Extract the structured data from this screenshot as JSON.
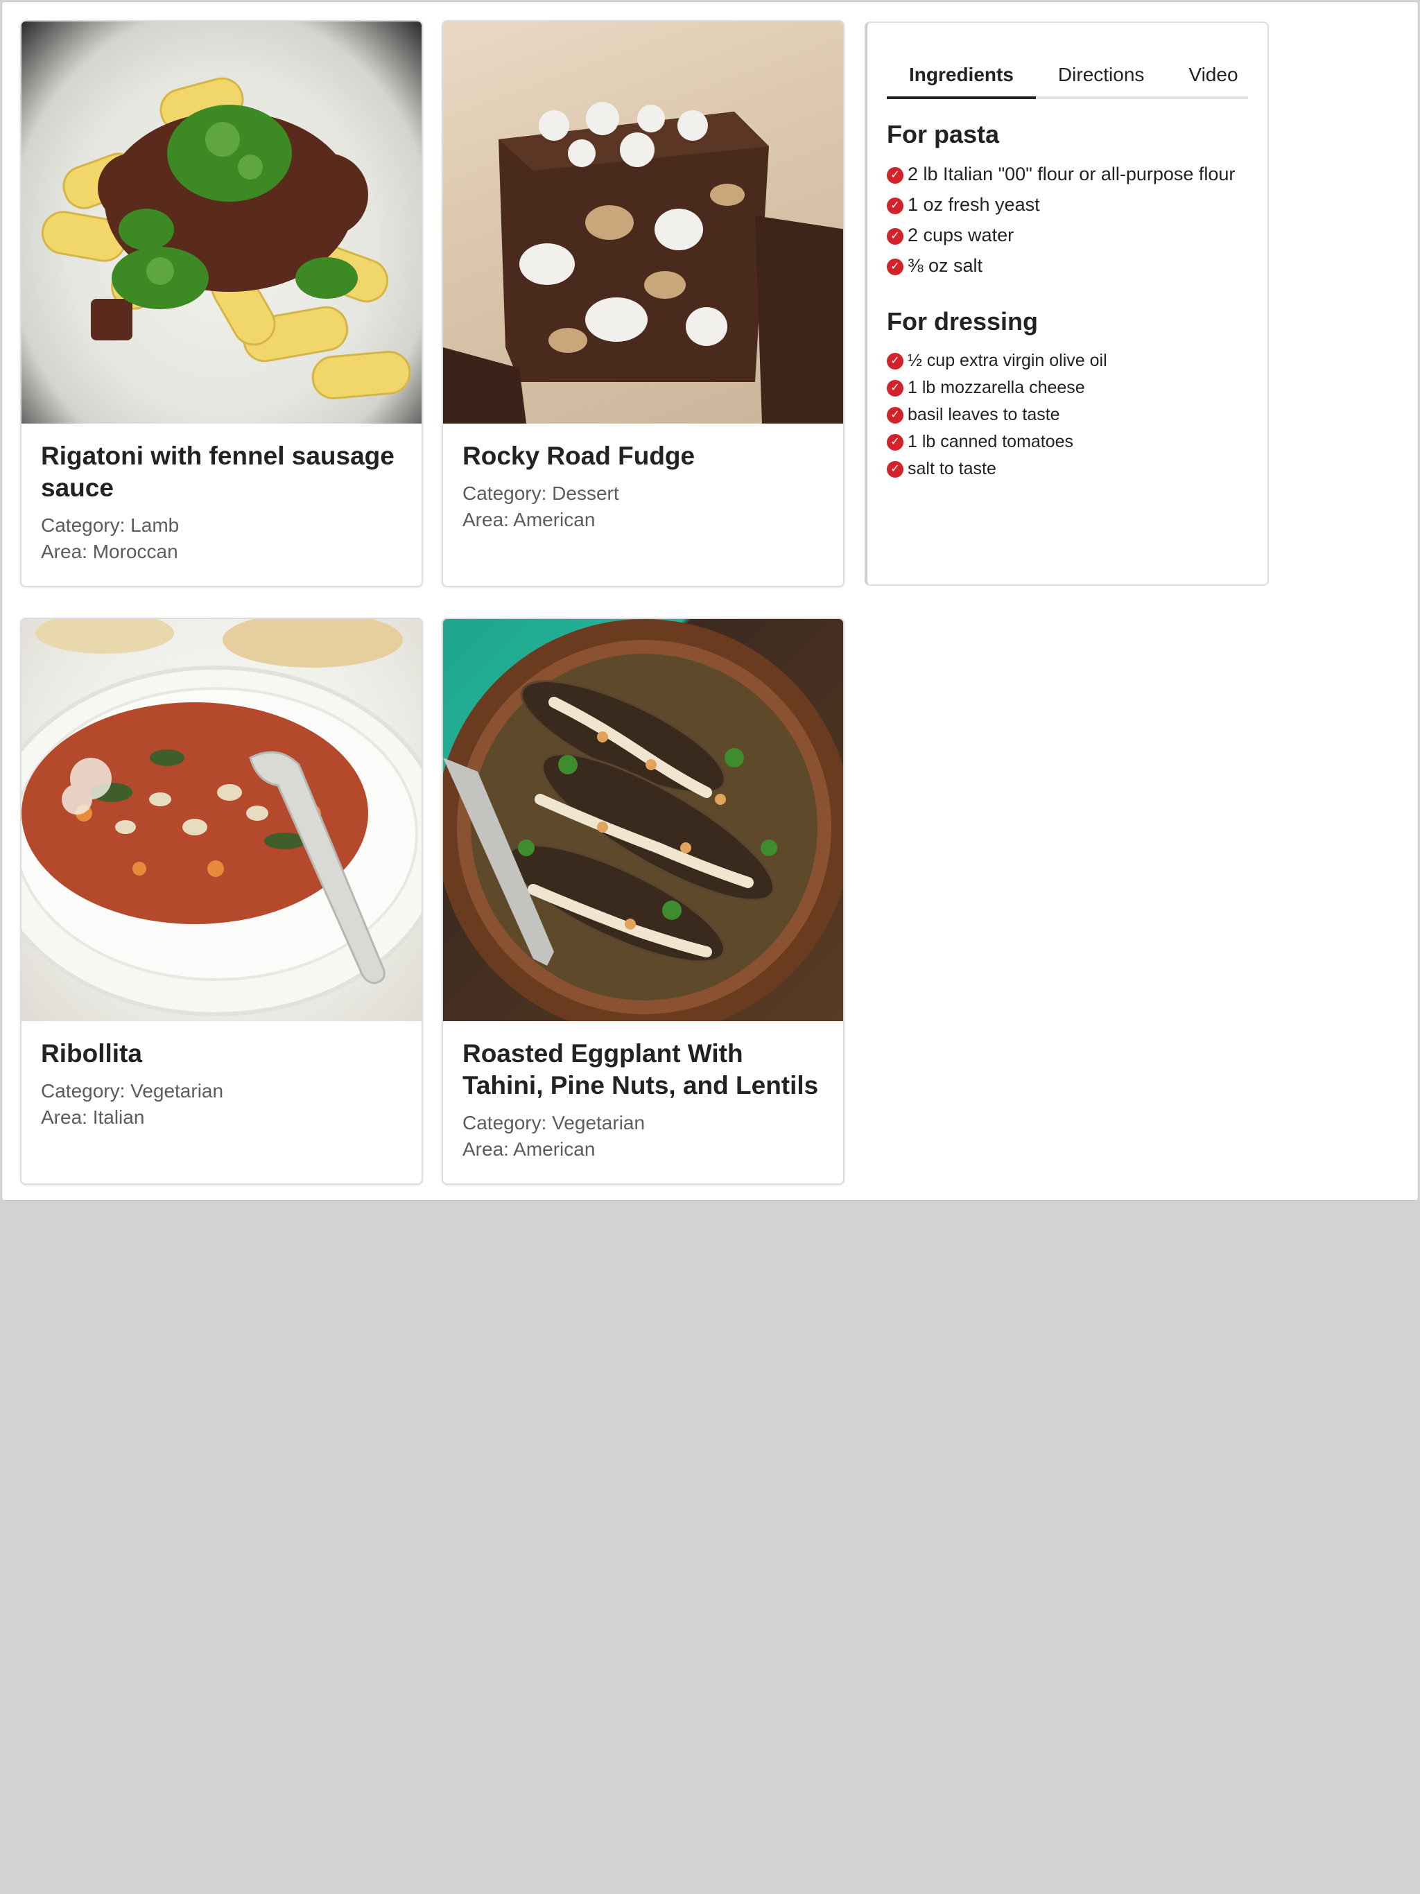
{
  "cards": [
    {
      "title": "Rigatoni with fennel sausage sauce",
      "category": "Category: Lamb",
      "area": "Area: Moroccan"
    },
    {
      "title": "Rocky Road Fudge",
      "category": "Category: Dessert",
      "area": "Area: American"
    },
    {
      "title": "Ribollita",
      "category": "Category: Vegetarian",
      "area": "Area: Italian"
    },
    {
      "title": "Roasted Eggplant With Tahini, Pine Nuts, and Lentils",
      "category": "Category: Vegetarian",
      "area": "Area: American"
    }
  ],
  "recipe": {
    "tabs": [
      "Ingredients",
      "Directions",
      "Video"
    ],
    "active_tab": "Ingredients",
    "sections": [
      {
        "title": "For pasta",
        "items": [
          "2 lb Italian \"00\" flour or all-purpose flour",
          "1 oz fresh yeast",
          "2 cups water",
          "⅜ oz salt"
        ]
      },
      {
        "title": "For dressing",
        "items": [
          "½ cup extra virgin olive oil",
          "1 lb mozzarella cheese",
          "basil leaves to taste",
          "1 lb canned tomatoes",
          "salt to taste"
        ]
      }
    ]
  },
  "colors": {
    "check": "#d2232a",
    "page_bg": "#d3d3d3",
    "panel_bg": "#ffffff"
  },
  "icons": {
    "check": "check-circle-icon"
  }
}
